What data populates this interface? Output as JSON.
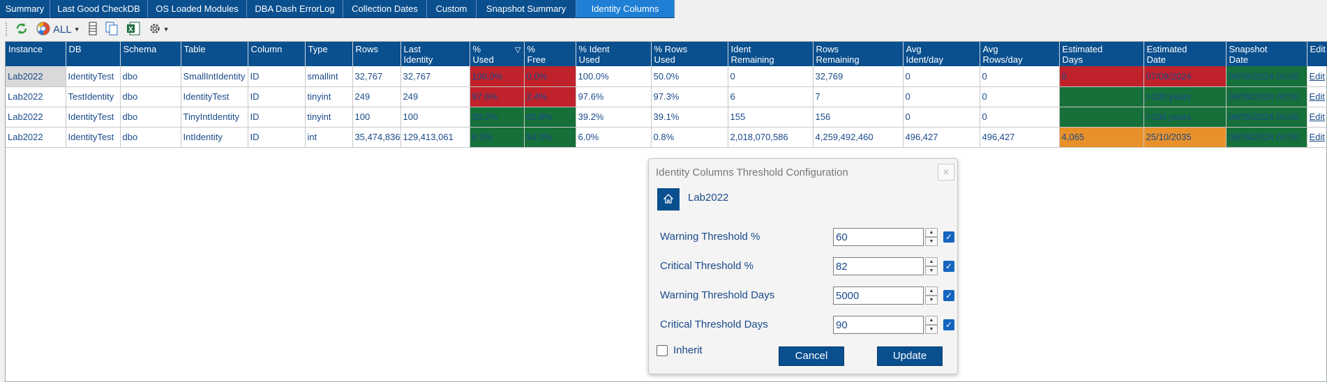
{
  "tabs": [
    {
      "label": "Summary",
      "active": false
    },
    {
      "label": "Last Good CheckDB",
      "active": false
    },
    {
      "label": "OS Loaded Modules",
      "active": false
    },
    {
      "label": "DBA Dash ErrorLog",
      "active": false
    },
    {
      "label": "Collection Dates",
      "active": false
    },
    {
      "label": "Custom",
      "active": false
    },
    {
      "label": "Snapshot Summary",
      "active": false
    },
    {
      "label": "Identity Columns",
      "active": true
    }
  ],
  "toolbar": {
    "refresh_icon": "refresh-icon",
    "filter_label": "ALL",
    "columns_icon": "columns-icon",
    "copy_icon": "copy-icon",
    "excel_icon": "excel-export-icon",
    "settings_icon": "gear-icon"
  },
  "grid": {
    "headers": [
      "Instance",
      "DB",
      "Schema",
      "Table",
      "Column",
      "Type",
      "Rows",
      "Last\nIdentity",
      "%\nUsed",
      "%\nFree",
      "% Ident\nUsed",
      "% Rows\nUsed",
      "Ident\nRemaining",
      "Rows\nRemaining",
      "Avg\nIdent/day",
      "Avg\nRows/day",
      "Estimated\nDays",
      "Estimated\nDate",
      "Snapshot\nDate",
      "Edit"
    ],
    "sorted_column": "% Used",
    "rows": [
      {
        "cells": [
          "Lab2022",
          "IdentityTest",
          "dbo",
          "SmallIntIdentity",
          "ID",
          "smallint",
          "32,767",
          "32,767",
          "100.0%",
          "0.0%",
          "100.0%",
          "50.0%",
          "0",
          "32,769",
          "0",
          "0",
          "0",
          "07/09/2024",
          "08/09/2024 00:00",
          "Edit"
        ],
        "status": {
          "used": "red",
          "free": "red",
          "days": "red",
          "date": "red",
          "snapshot": "green"
        }
      },
      {
        "cells": [
          "Lab2022",
          "TestIdentity",
          "dbo",
          "IdentityTest",
          "ID",
          "tinyint",
          "249",
          "249",
          "97.6%",
          "2.4%",
          "97.6%",
          "97.3%",
          "6",
          "7",
          "0",
          "0",
          "",
          ">100 years",
          "08/09/2024 00:00",
          "Edit"
        ],
        "status": {
          "used": "red",
          "free": "red",
          "days": "green",
          "date": "green",
          "snapshot": "green"
        }
      },
      {
        "cells": [
          "Lab2022",
          "IdentityTest",
          "dbo",
          "TinyIntIdentity",
          "ID",
          "tinyint",
          "100",
          "100",
          "39.2%",
          "60.8%",
          "39.2%",
          "39.1%",
          "155",
          "156",
          "0",
          "0",
          "",
          ">100 years",
          "08/09/2024 00:00",
          "Edit"
        ],
        "status": {
          "used": "green",
          "free": "green",
          "days": "green",
          "date": "green",
          "snapshot": "green"
        }
      },
      {
        "cells": [
          "Lab2022",
          "IdentityTest",
          "dbo",
          "IntIdentity",
          "ID",
          "int",
          "35,474,836",
          "129,413,061",
          "6.0%",
          "94.0%",
          "6.0%",
          "0.8%",
          "2,018,070,586",
          "4,259,492,460",
          "496,427",
          "496,427",
          "4,065",
          "25/10/2035",
          "08/09/2024 00:00",
          "Edit"
        ],
        "status": {
          "used": "green",
          "free": "green",
          "days": "orange",
          "date": "orange",
          "snapshot": "green"
        }
      }
    ]
  },
  "dialog": {
    "title": "Identity Columns Threshold Configuration",
    "close_icon": "close-icon",
    "home_icon": "home-icon",
    "instance": "Lab2022",
    "fields": [
      {
        "label": "Warning Threshold %",
        "value": "60",
        "checked": true
      },
      {
        "label": "Critical Threshold %",
        "value": "82",
        "checked": true
      },
      {
        "label": "Warning Threshold Days",
        "value": "5000",
        "checked": true
      },
      {
        "label": "Critical Threshold Days",
        "value": "90",
        "checked": true
      }
    ],
    "inherit_label": "Inherit",
    "inherit_checked": false,
    "cancel_label": "Cancel",
    "update_label": "Update"
  },
  "colors": {
    "header_blue": "#0a4f8e",
    "active_tab": "#1e7fd4",
    "status_red": "#c0222b",
    "status_green": "#16703a",
    "status_orange": "#e8912a",
    "text_blue": "#1a4a8a"
  }
}
